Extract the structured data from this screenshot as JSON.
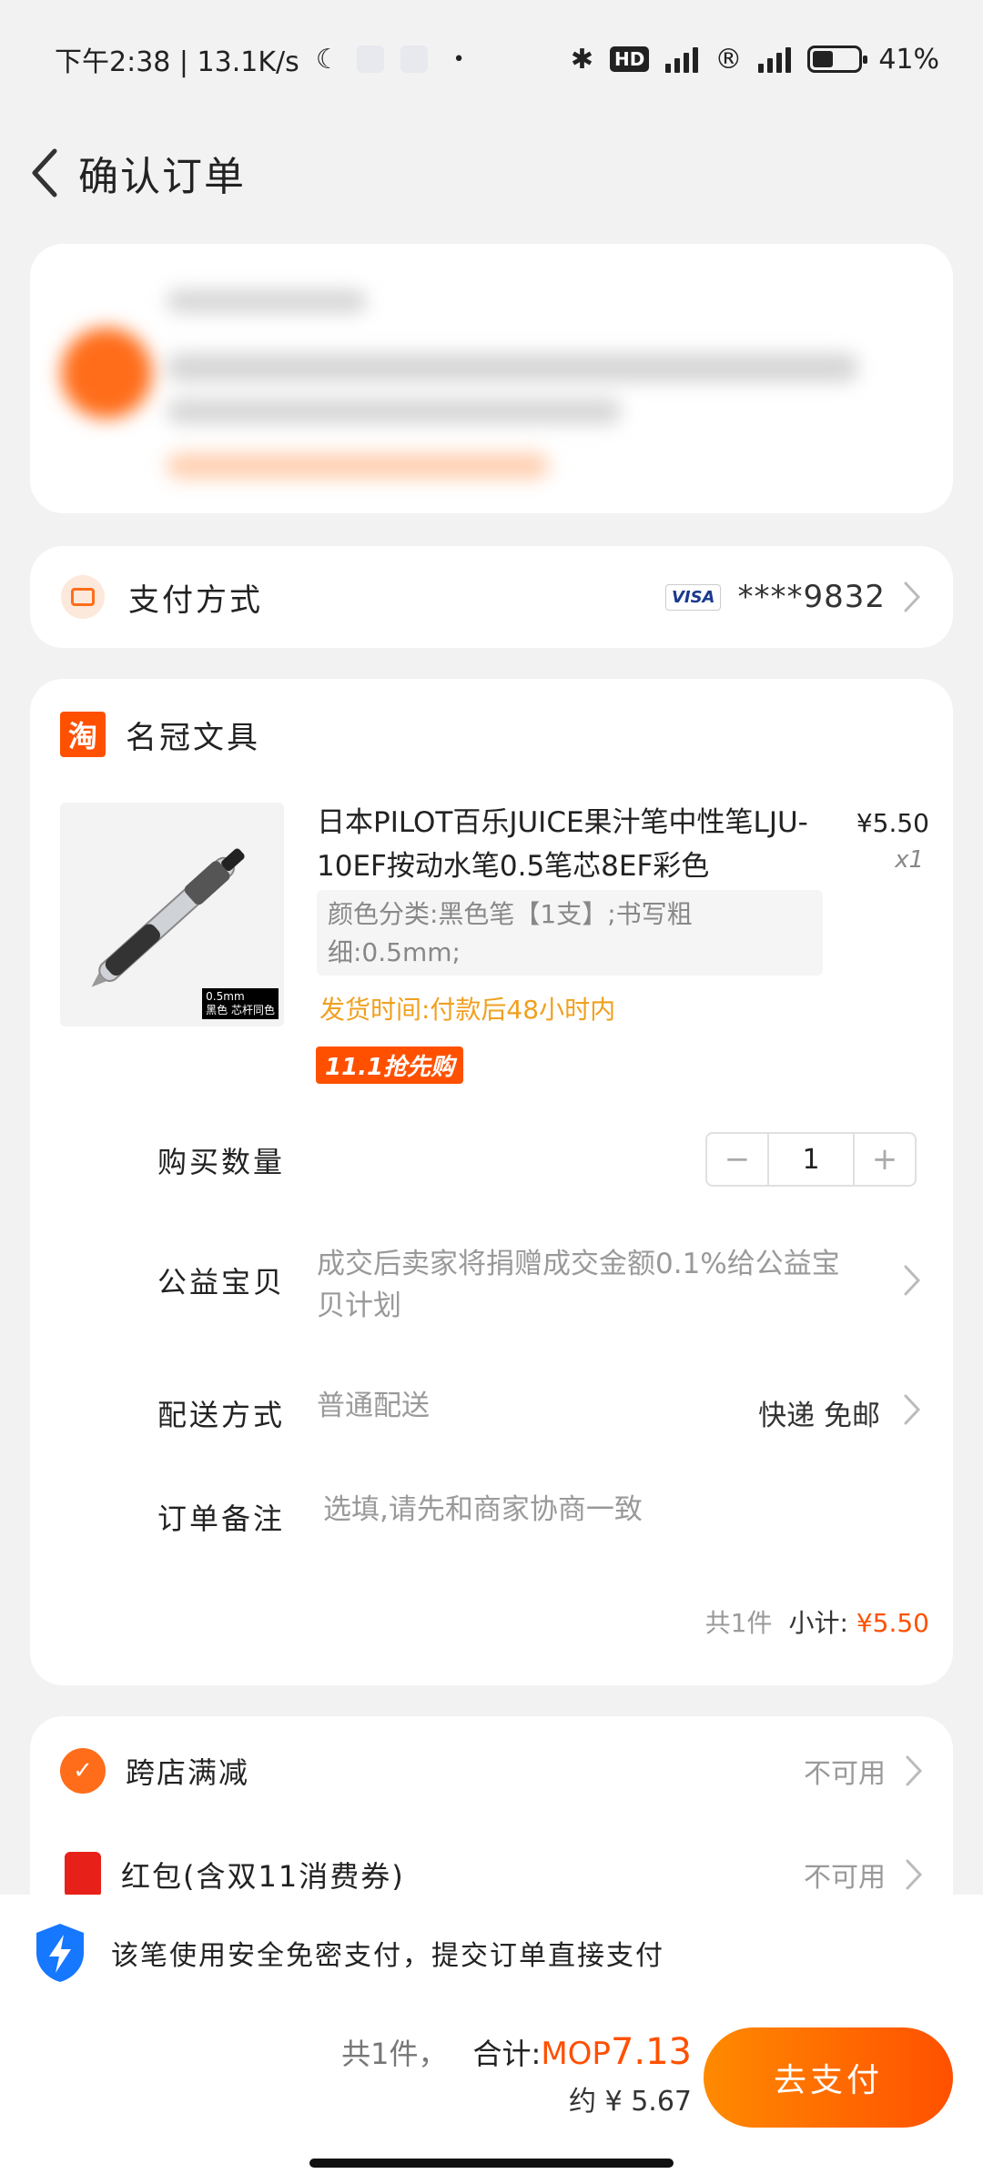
{
  "status_bar": {
    "time_speed": "下午2:38 | 13.1K/s",
    "network_hd": "HD",
    "battery": "41%"
  },
  "header": {
    "title": "确认订单"
  },
  "payment": {
    "label": "支付方式",
    "card_brand": "VISA",
    "card_number": "****9832"
  },
  "shop": {
    "logo_char": "淘",
    "name": "名冠文具"
  },
  "product": {
    "title": "日本PILOT百乐JUICE果汁笔中性笔LJU-10EF按动水笔0.5笔芯8EF彩色",
    "price": "¥5.50",
    "qty": "x1",
    "spec": "颜色分类:黑色笔【1支】;书写粗细:0.5mm;",
    "ship_time": "发货时间:付款后48小时内",
    "promo": "11.1抢先购",
    "image_tag_1": "0.5mm",
    "image_tag_2": "黑色 芯杆同色"
  },
  "rows": {
    "quantity_label": "购买数量",
    "quantity_value": "1",
    "minus": "−",
    "plus": "+",
    "charity_label": "公益宝贝",
    "charity_text": "成交后卖家将捐赠成交金额0.1%给公益宝贝计划",
    "delivery_label": "配送方式",
    "delivery_value": "普通配送",
    "delivery_right": "快递 免邮",
    "note_label": "订单备注",
    "note_placeholder": "选填,请先和商家协商一致"
  },
  "subtotal": {
    "count": "共1件",
    "label": "小计:",
    "amount": "¥5.50"
  },
  "discounts": [
    {
      "label": "跨店满减",
      "status": "不可用"
    },
    {
      "label": "红包(含双11消费券)",
      "status": "不可用"
    }
  ],
  "bottom": {
    "secure_text": "该笔使用安全免密支付，提交订单直接支付",
    "count": "共1件，",
    "total_label": "合计:",
    "currency": "MOP",
    "amount": "7.13",
    "approx": "约 ¥ 5.67",
    "pay_button": "去支付"
  },
  "colors": {
    "accent": "#ff5000",
    "background": "#f2f2f2"
  }
}
